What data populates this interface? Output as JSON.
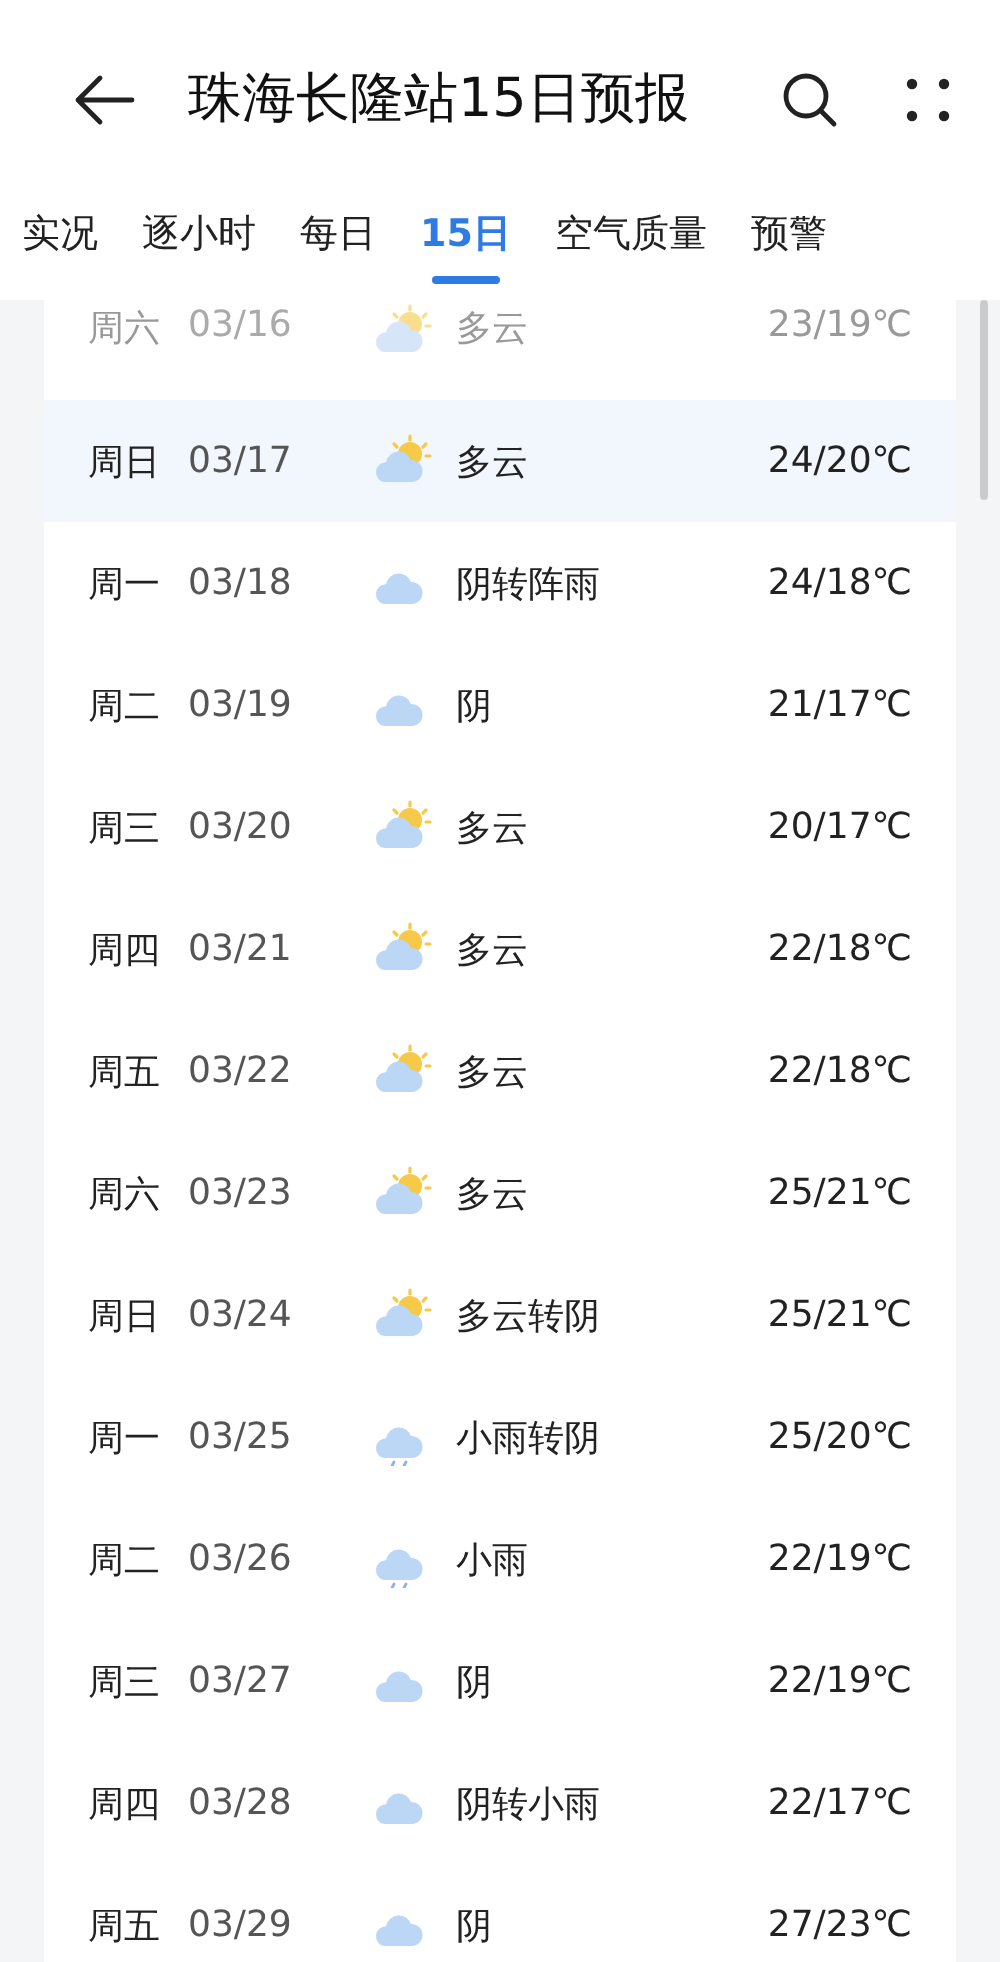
{
  "header": {
    "title": "珠海长隆站15日预报"
  },
  "tabs": [
    {
      "label": "实况",
      "selected": false
    },
    {
      "label": "逐小时",
      "selected": false
    },
    {
      "label": "每日",
      "selected": false
    },
    {
      "label": "15日",
      "selected": true
    },
    {
      "label": "空气质量",
      "selected": false
    },
    {
      "label": "预警",
      "selected": false
    }
  ],
  "days": [
    {
      "weekday": "周六",
      "date": "03/16",
      "kind": "partly-cloudy",
      "condition": "多云",
      "temp": "23/19℃",
      "past": true,
      "selected": false
    },
    {
      "weekday": "周日",
      "date": "03/17",
      "kind": "partly-cloudy",
      "condition": "多云",
      "temp": "24/20℃",
      "past": false,
      "selected": true
    },
    {
      "weekday": "周一",
      "date": "03/18",
      "kind": "cloudy",
      "condition": "阴转阵雨",
      "temp": "24/18℃",
      "past": false,
      "selected": false
    },
    {
      "weekday": "周二",
      "date": "03/19",
      "kind": "cloudy",
      "condition": "阴",
      "temp": "21/17℃",
      "past": false,
      "selected": false
    },
    {
      "weekday": "周三",
      "date": "03/20",
      "kind": "partly-cloudy",
      "condition": "多云",
      "temp": "20/17℃",
      "past": false,
      "selected": false
    },
    {
      "weekday": "周四",
      "date": "03/21",
      "kind": "partly-cloudy",
      "condition": "多云",
      "temp": "22/18℃",
      "past": false,
      "selected": false
    },
    {
      "weekday": "周五",
      "date": "03/22",
      "kind": "partly-cloudy",
      "condition": "多云",
      "temp": "22/18℃",
      "past": false,
      "selected": false
    },
    {
      "weekday": "周六",
      "date": "03/23",
      "kind": "partly-cloudy",
      "condition": "多云",
      "temp": "25/21℃",
      "past": false,
      "selected": false
    },
    {
      "weekday": "周日",
      "date": "03/24",
      "kind": "partly-cloudy",
      "condition": "多云转阴",
      "temp": "25/21℃",
      "past": false,
      "selected": false
    },
    {
      "weekday": "周一",
      "date": "03/25",
      "kind": "rain",
      "condition": "小雨转阴",
      "temp": "25/20℃",
      "past": false,
      "selected": false
    },
    {
      "weekday": "周二",
      "date": "03/26",
      "kind": "rain",
      "condition": "小雨",
      "temp": "22/19℃",
      "past": false,
      "selected": false
    },
    {
      "weekday": "周三",
      "date": "03/27",
      "kind": "cloudy",
      "condition": "阴",
      "temp": "22/19℃",
      "past": false,
      "selected": false
    },
    {
      "weekday": "周四",
      "date": "03/28",
      "kind": "cloudy",
      "condition": "阴转小雨",
      "temp": "22/17℃",
      "past": false,
      "selected": false
    },
    {
      "weekday": "周五",
      "date": "03/29",
      "kind": "cloudy",
      "condition": "阴",
      "temp": "27/23℃",
      "past": false,
      "selected": false
    }
  ]
}
